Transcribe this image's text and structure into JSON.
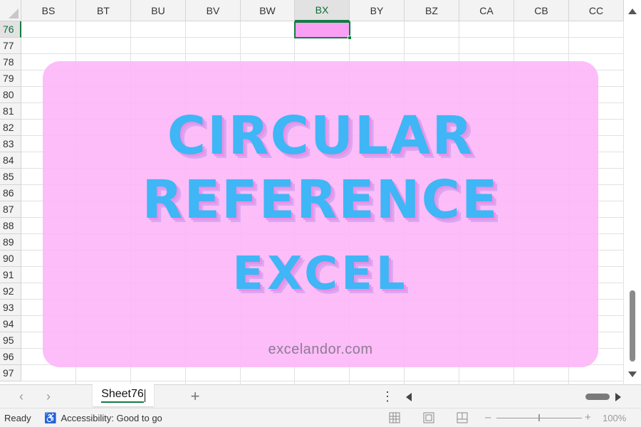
{
  "grid": {
    "columns": [
      "BS",
      "BT",
      "BU",
      "BV",
      "BW",
      "BX",
      "BY",
      "BZ",
      "CA",
      "CB",
      "CC"
    ],
    "active_column": "BX",
    "rows": [
      "76",
      "77",
      "78",
      "79",
      "80",
      "81",
      "82",
      "83",
      "84",
      "85",
      "86",
      "87",
      "88",
      "89",
      "90",
      "91",
      "92",
      "93",
      "94",
      "95",
      "96",
      "97"
    ],
    "active_row": "76",
    "active_cell": "BX76",
    "active_cell_fill": "#f9a0f4"
  },
  "banner": {
    "line1": "CIRCULAR",
    "line2": "REFERENCE",
    "line3": "EXCEL",
    "website": "excelandor.com",
    "background": "#fcb4f8",
    "title_color": "#3fb6f5",
    "shadow_color": "#ee8fe4"
  },
  "tabs": {
    "prev_icon": "‹",
    "next_icon": "›",
    "sheet_name": "Sheet76",
    "add_icon": "+",
    "more_icon": "⋮"
  },
  "status": {
    "ready": "Ready",
    "accessibility_icon": "♿",
    "accessibility": "Accessibility: Good to go",
    "zoom_minus": "–",
    "zoom_plus": "+",
    "zoom": "100%",
    "zoom_level": 100
  },
  "colors": {
    "excel_green": "#107c41",
    "header_bg": "#f3f3f3"
  }
}
